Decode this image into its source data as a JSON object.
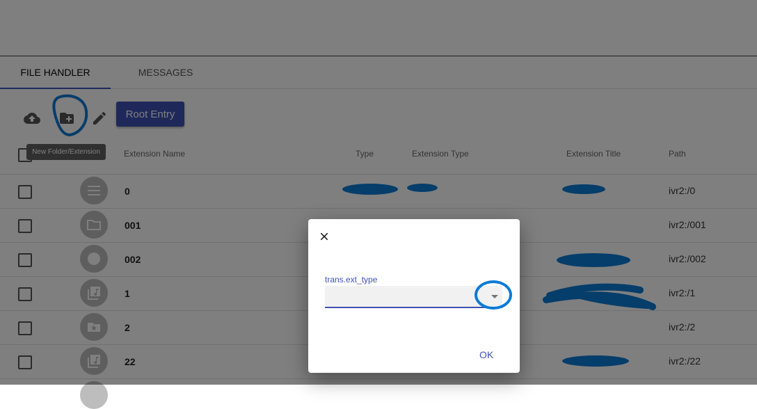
{
  "tabs": [
    {
      "label": "FILE HANDLER",
      "active": true
    },
    {
      "label": "MESSAGES",
      "active": false
    }
  ],
  "toolbar": {
    "upload_icon": "cloud-upload-icon",
    "new_folder_icon": "create-new-folder-icon",
    "edit_icon": "edit-pencil-icon",
    "root_entry_label": "Root Entry",
    "tooltip": "New Folder/Extension"
  },
  "table": {
    "headers": [
      "Extension Name",
      "Type",
      "Extension Type",
      "Extension Title",
      "Path"
    ],
    "rows": [
      {
        "name": "0",
        "path": "ivr2:/0",
        "icon": "menu-icon"
      },
      {
        "name": "001",
        "path": "ivr2:/001",
        "icon": "folder-icon"
      },
      {
        "name": "002",
        "path": "ivr2:/002",
        "icon": "record-icon"
      },
      {
        "name": "1",
        "path": "ivr2:/1",
        "icon": "music-library-icon"
      },
      {
        "name": "2",
        "path": "ivr2:/2",
        "icon": "folder-star-icon"
      },
      {
        "name": "22",
        "path": "ivr2:/22",
        "icon": "music-library-icon"
      }
    ]
  },
  "dialog": {
    "field_label": "trans.ext_type",
    "field_value": "",
    "ok_label": "OK"
  },
  "colors": {
    "primary": "#3f51b5",
    "annotation": "#0b7bd6"
  }
}
